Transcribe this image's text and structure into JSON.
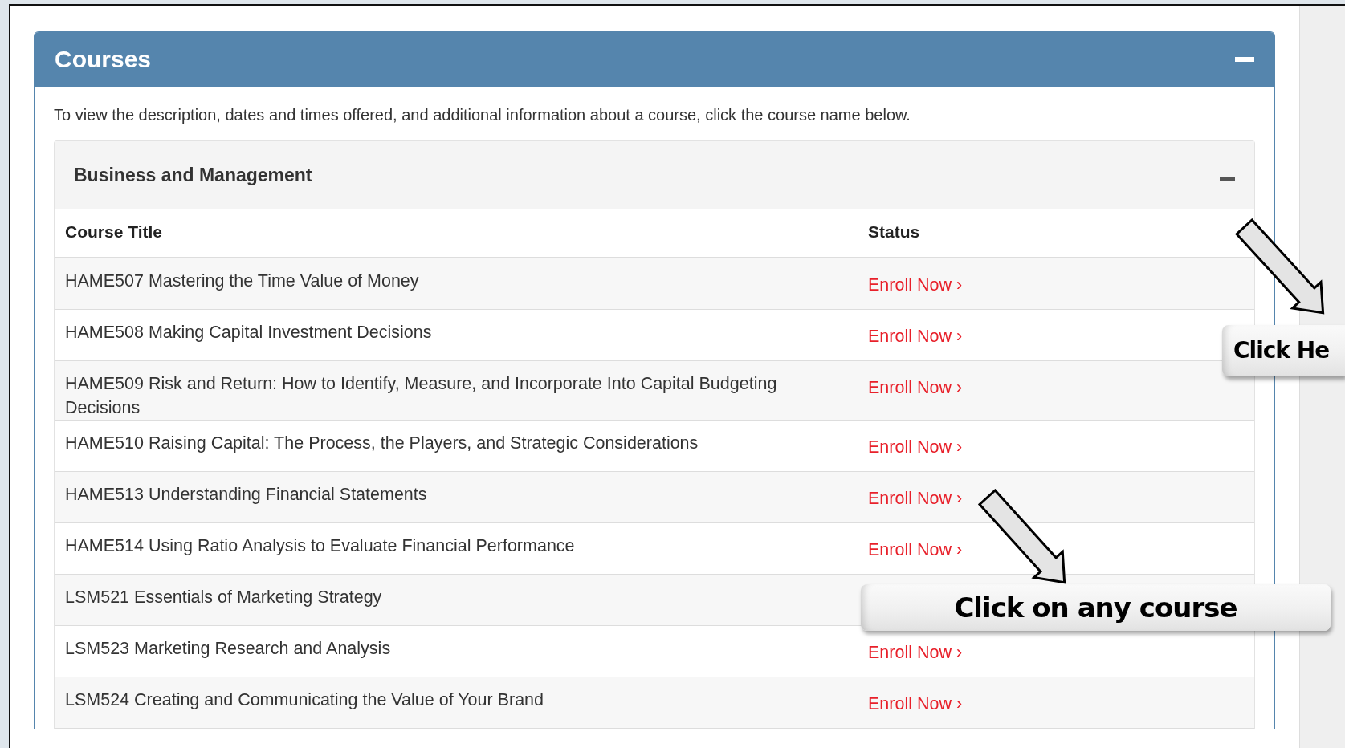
{
  "panel": {
    "title": "Courses",
    "expanded": true,
    "description": "To view the description, dates and times offered, and additional information about a course, click the course name below."
  },
  "category": {
    "title": "Business and Management",
    "expanded": true
  },
  "table": {
    "columns": [
      "Course Title",
      "Status"
    ],
    "rows": [
      {
        "title": "HAME507 Mastering the Time Value of Money",
        "status": "Enroll Now ›"
      },
      {
        "title": "HAME508 Making Capital Investment Decisions",
        "status": "Enroll Now ›"
      },
      {
        "title": "HAME509 Risk and Return: How to Identify, Measure, and Incorporate Into Capital Budgeting Decisions",
        "status": "Enroll Now ›"
      },
      {
        "title": "HAME510 Raising Capital: The Process, the Players, and Strategic Considerations",
        "status": "Enroll Now ›"
      },
      {
        "title": "HAME513 Understanding Financial Statements",
        "status": "Enroll Now ›"
      },
      {
        "title": "HAME514 Using Ratio Analysis to Evaluate Financial Performance",
        "status": "Enroll Now ›"
      },
      {
        "title": "LSM521 Essentials of Marketing Strategy"
      },
      {
        "title": "LSM523 Marketing Research and Analysis",
        "status": "Enroll Now ›"
      },
      {
        "title": "LSM524 Creating and Communicating the Value of Your Brand",
        "status": "Enroll Now ›"
      }
    ]
  },
  "annotations": [
    {
      "text": "Click He"
    },
    {
      "text": "Click on any course"
    }
  ]
}
